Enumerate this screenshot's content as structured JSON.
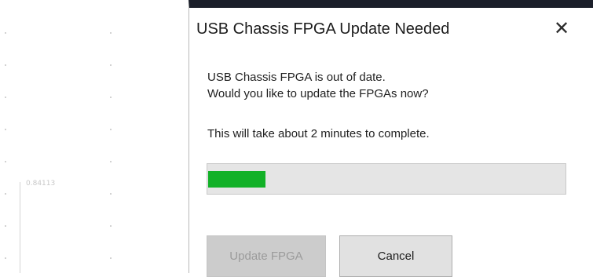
{
  "background": {
    "value_label": "0.84113"
  },
  "dialog": {
    "title": "USB Chassis FPGA Update Needed",
    "close_glyph": "✕",
    "message_line1": "USB Chassis FPGA is out of date.",
    "message_line2": "Would you like to update the FPGAs now?",
    "duration_text": "This will take about 2 minutes to complete.",
    "progress_percent": 16,
    "update_button_label": "Update FPGA",
    "update_button_disabled": true,
    "cancel_button_label": "Cancel"
  },
  "colors": {
    "progress_fill": "#12b127",
    "title_bar_strip": "#1b1f2a"
  },
  "icons": {
    "close": "close-icon"
  }
}
